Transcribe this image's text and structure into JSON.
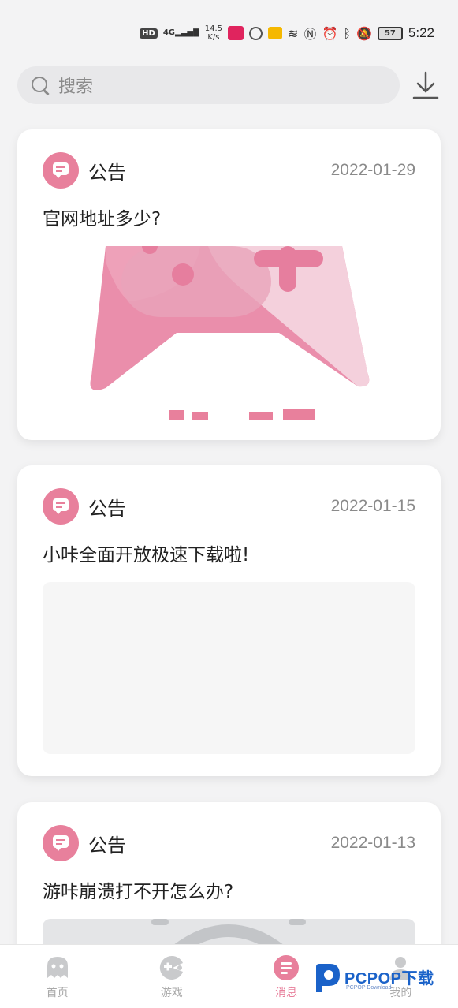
{
  "status_bar": {
    "hd": "HD",
    "signal": "4G",
    "speed_value": "14.5",
    "speed_unit": "K/s",
    "battery": "57",
    "time": "5:22"
  },
  "search": {
    "placeholder": "搜索"
  },
  "posts": [
    {
      "type": "公告",
      "date": "2022-01-29",
      "title": "官网地址多少?"
    },
    {
      "type": "公告",
      "date": "2022-01-15",
      "title": "小咔全面开放极速下载啦!"
    },
    {
      "type": "公告",
      "date": "2022-01-13",
      "title": "游咔崩溃打不开怎么办?"
    }
  ],
  "tabs": [
    {
      "label": "首页",
      "icon": "ghost-icon"
    },
    {
      "label": "游戏",
      "icon": "gamepad-icon"
    },
    {
      "label": "消息",
      "icon": "message-icon",
      "active": true
    },
    {
      "label": "我的",
      "icon": "user-icon"
    }
  ],
  "watermark": {
    "brand": "PCPOP下载",
    "sub": "PCPOP Download"
  },
  "colors": {
    "accent": "#e8809c",
    "background": "#f3f3f4"
  }
}
